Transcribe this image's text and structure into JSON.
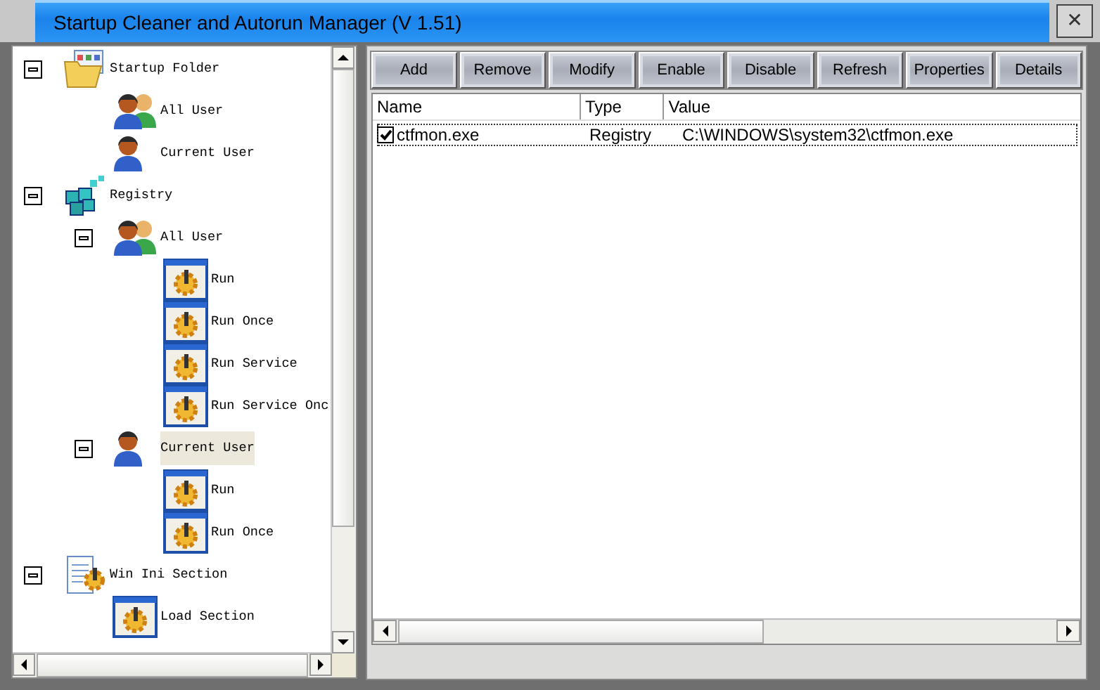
{
  "window": {
    "title": "Startup Cleaner and Autorun Manager (V 1.51)",
    "close": "✕"
  },
  "tree": [
    {
      "label": "Startup Folder",
      "kind": "folder",
      "expanded": true,
      "selected": false,
      "children": [
        {
          "label": "All User",
          "kind": "users",
          "selected": false
        },
        {
          "label": "Current User",
          "kind": "user",
          "selected": false
        }
      ]
    },
    {
      "label": "Registry",
      "kind": "registry",
      "expanded": true,
      "selected": false,
      "children": [
        {
          "label": "All User",
          "kind": "users",
          "expanded": true,
          "selected": false,
          "children": [
            {
              "label": "Run",
              "kind": "entry",
              "selected": false
            },
            {
              "label": "Run Once",
              "kind": "entry",
              "selected": false
            },
            {
              "label": "Run Service",
              "kind": "entry",
              "selected": false
            },
            {
              "label": "Run Service Onc",
              "kind": "entry",
              "selected": false
            }
          ]
        },
        {
          "label": "Current User",
          "kind": "user",
          "expanded": true,
          "selected": true,
          "children": [
            {
              "label": "Run",
              "kind": "entry",
              "selected": false
            },
            {
              "label": "Run Once",
              "kind": "entry",
              "selected": false
            }
          ]
        }
      ]
    },
    {
      "label": "Win Ini Section",
      "kind": "ini",
      "expanded": true,
      "selected": false,
      "children": [
        {
          "label": "Load Section",
          "kind": "entry",
          "selected": false
        }
      ]
    }
  ],
  "toolbar": [
    "Add",
    "Remove",
    "Modify",
    "Enable",
    "Disable",
    "Refresh",
    "Properties",
    "Details"
  ],
  "list": {
    "columns": [
      "Name",
      "Type",
      "Value"
    ],
    "rows": [
      {
        "name": "ctfmon.exe",
        "type": "Registry",
        "value": "C:\\WINDOWS\\system32\\ctfmon.exe",
        "checked": true,
        "focused": true
      }
    ]
  }
}
